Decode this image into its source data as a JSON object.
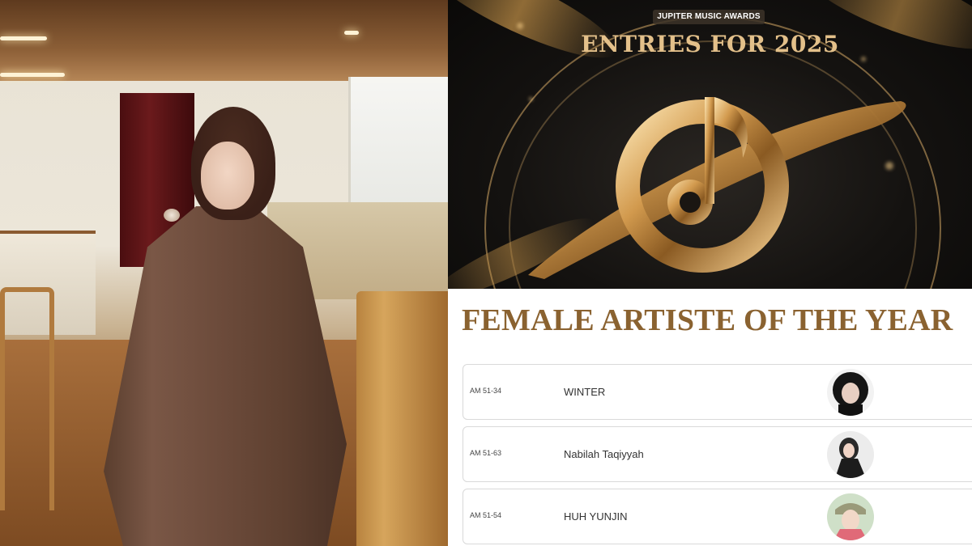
{
  "poster": {
    "event_name": "JUPITER MUSIC AWARDS",
    "title": "ENTRIES FOR 2025",
    "logo_icon": "planet-music-note-logo-icon",
    "accent_color": "#e3c08a"
  },
  "category": {
    "title": "FEMALE ARTISTE OF THE YEAR",
    "color": "#8a6230"
  },
  "nominees": [
    {
      "code": "AM 51-34",
      "name": "WINTER"
    },
    {
      "code": "AM 51-63",
      "name": "Nabilah Taqiyyah"
    },
    {
      "code": "AM 51-54",
      "name": "HUH YUNJIN"
    }
  ]
}
